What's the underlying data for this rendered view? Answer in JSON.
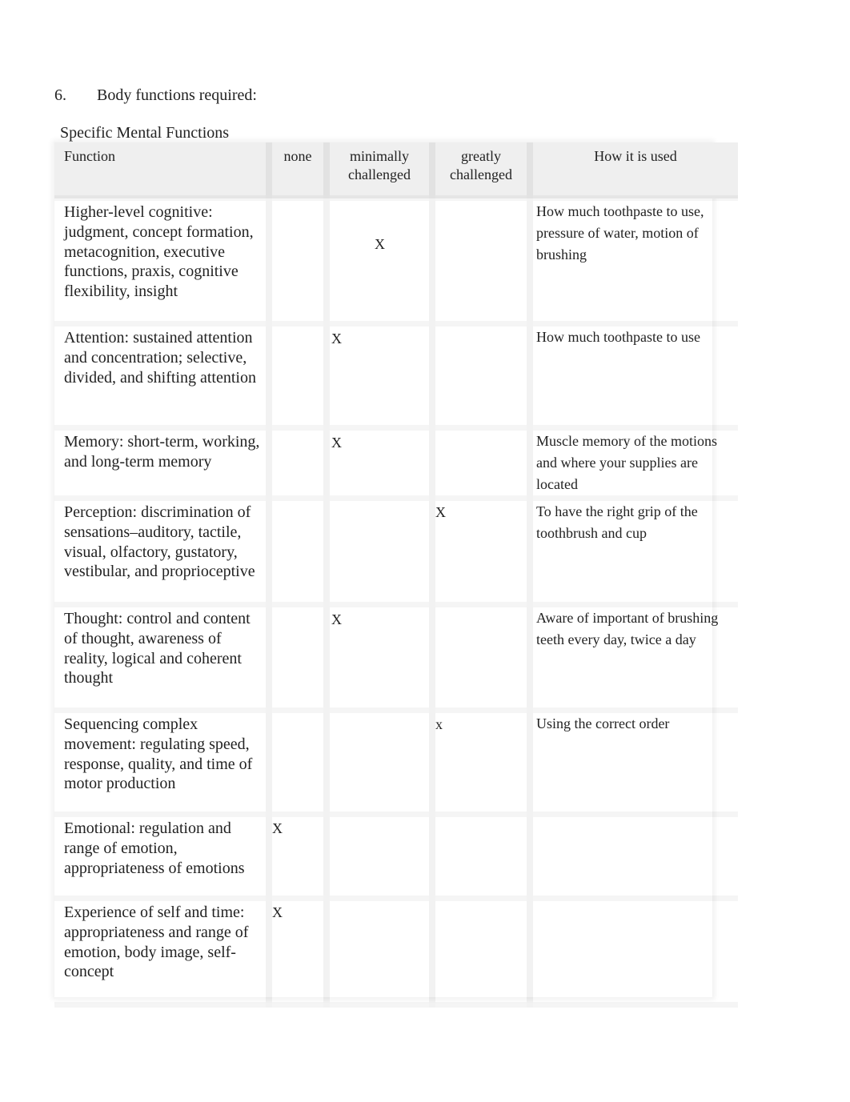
{
  "section": {
    "number": "6.",
    "title": "Body functions required:"
  },
  "table_caption": "Specific Mental Functions",
  "columns": {
    "function": "Function",
    "none": "none",
    "minimally": "minimally challenged",
    "greatly": "greatly challenged",
    "how": "How it is used"
  },
  "rows": [
    {
      "function": "Higher-level cognitive: judgment, concept formation, metacognition, executive functions, praxis, cognitive flexibility, insight",
      "none": "",
      "minimally": "X",
      "greatly": "",
      "how": "How much toothpaste to use, pressure of water, motion of brushing"
    },
    {
      "function": "Attention: sustained attention and concentration; selective, divided, and shifting attention",
      "none": "",
      "minimally": "X",
      "greatly": "",
      "how": "How much toothpaste to use"
    },
    {
      "function": "Memory: short-term, working, and long-term memory",
      "none": "",
      "minimally": "X",
      "greatly": "",
      "how": "Muscle memory of the motions and where your supplies are located"
    },
    {
      "function": "Perception: discrimination of sensations–auditory, tactile, visual, olfactory, gustatory, vestibular, and proprioceptive",
      "none": "",
      "minimally": "",
      "greatly": "X",
      "how": "To have the right grip of the toothbrush and cup"
    },
    {
      "function": "Thought: control and content of thought, awareness of reality, logical and coherent thought",
      "none": "",
      "minimally": "X",
      "greatly": "",
      "how": "Aware of important of brushing teeth every day, twice a day"
    },
    {
      "function": "Sequencing complex movement: regulating speed, response, quality, and time of motor production",
      "none": "",
      "minimally": "",
      "greatly": "x",
      "how": "Using the correct order"
    },
    {
      "function": "Emotional: regulation and range of emotion, appropriateness of emotions",
      "none": "X",
      "minimally": "",
      "greatly": "",
      "how": ""
    },
    {
      "function": "Experience of self and time: appropriateness and range of emotion, body image, self-concept",
      "none": "X",
      "minimally": "",
      "greatly": "",
      "how": ""
    }
  ]
}
